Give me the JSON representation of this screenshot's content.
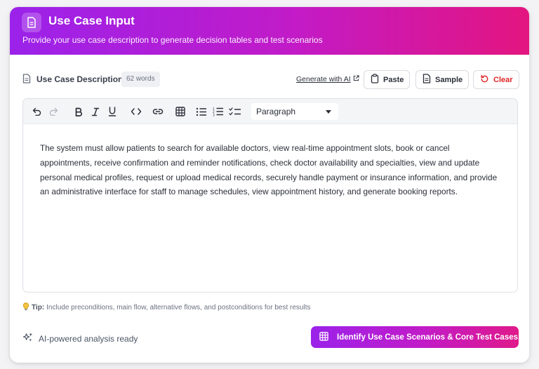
{
  "header": {
    "title": "Use Case Input",
    "subtitle": "Provide your use case description to generate decision tables and test scenarios",
    "icon": "document-icon"
  },
  "description_section": {
    "label": "Use Case Description",
    "word_count": "62 words",
    "generate_link": "Generate with AI",
    "paste_label": "Paste",
    "sample_label": "Sample",
    "clear_label": "Clear"
  },
  "toolbar": {
    "format_select_value": "Paragraph",
    "icons": [
      "undo-icon",
      "redo-icon",
      "bold-icon",
      "italic-icon",
      "underline-icon",
      "code-icon",
      "link-icon",
      "table-icon",
      "bullet-list-icon",
      "numbered-list-icon",
      "task-list-icon"
    ]
  },
  "editor": {
    "content": "The system must allow patients to search for available doctors, view real-time appointment slots, book or cancel appointments, receive confirmation and reminder notifications, check doctor availability and specialties, view and update personal medical profiles, request or upload medical records, securely handle payment or insurance information, and provide an administrative interface for staff to manage schedules, view appointment history, and generate booking reports."
  },
  "tip": {
    "label": "Tip:",
    "text": "Include preconditions, main flow, alternative flows, and postconditions for best results"
  },
  "footer": {
    "ai_status": "AI-powered analysis ready",
    "primary_button": "Identify Use Case Scenarios & Core Test Cases"
  },
  "colors": {
    "gradient_start": "#9b22ea",
    "gradient_end": "#e3157f",
    "clear_red": "#dc2626"
  }
}
